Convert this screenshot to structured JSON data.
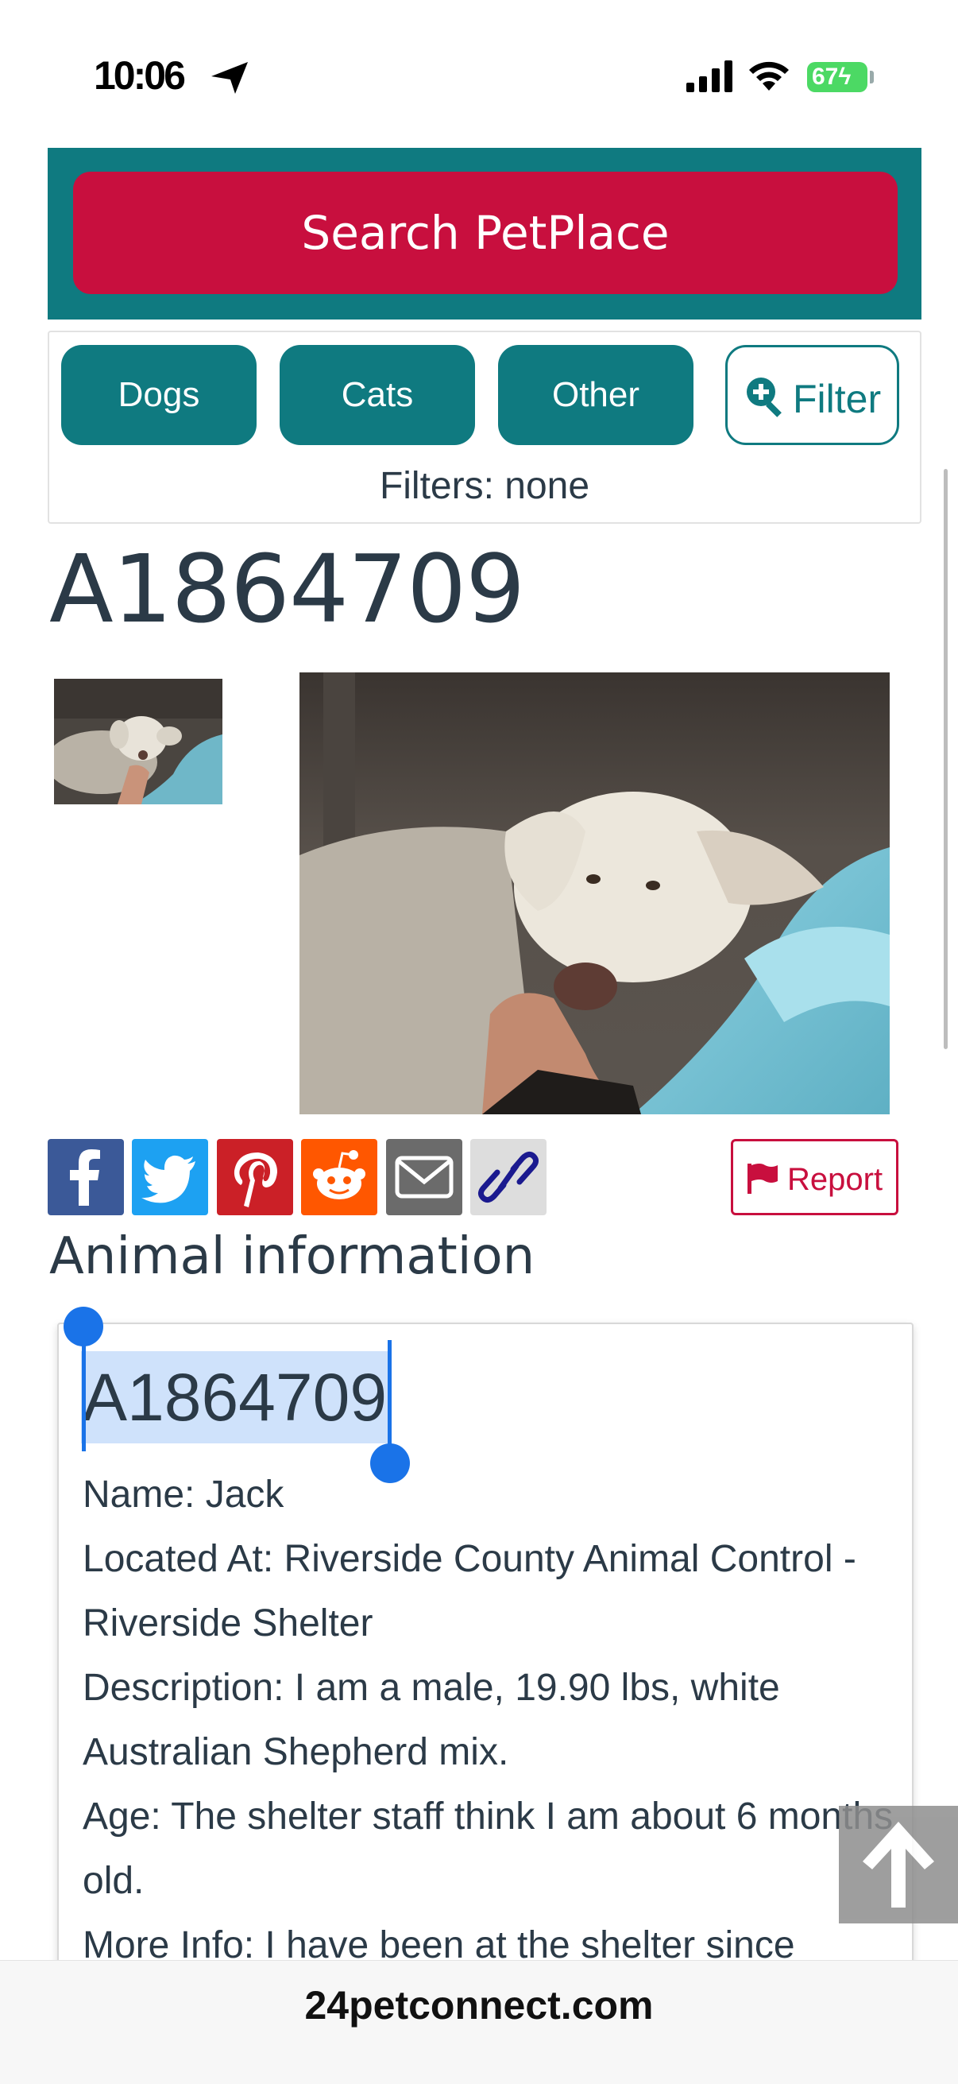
{
  "status_bar": {
    "time": "10:06",
    "battery": "67"
  },
  "header": {
    "search_label": "Search PetPlace"
  },
  "filters": {
    "pills": [
      "Dogs",
      "Cats",
      "Other"
    ],
    "filter_label": "Filter",
    "status": "Filters: none"
  },
  "animal": {
    "id": "A1864709",
    "section_heading": "Animal information",
    "report_label": "Report",
    "info_lines": [
      "Name: Jack",
      "Located At: Riverside County Animal Control - Riverside Shelter",
      "Description: I am a male, 19.90 lbs, white Australian Shepherd mix.",
      "Age: The shelter staff think I am about 6 months old.",
      "More Info: I have been at the shelter since"
    ]
  },
  "share_icons": [
    "facebook-icon",
    "twitter-icon",
    "pinterest-icon",
    "reddit-icon",
    "mail-icon",
    "link-icon"
  ],
  "browser": {
    "url": "24petconnect.com"
  },
  "colors": {
    "teal": "#0f7a80",
    "crimson": "#c80f3e",
    "text": "#2b3a47",
    "selection": "#1a73e8"
  }
}
